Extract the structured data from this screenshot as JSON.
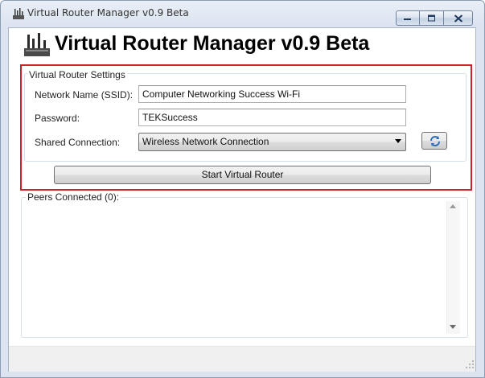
{
  "window": {
    "title": "Virtual Router Manager v0.9 Beta"
  },
  "header": {
    "heading": "Virtual Router Manager v0.9 Beta"
  },
  "settings": {
    "group_label": "Virtual Router Settings",
    "ssid_label": "Network Name (SSID):",
    "ssid_value": "Computer Networking Success Wi-Fi",
    "password_label": "Password:",
    "password_value": "TEKSuccess",
    "shared_label": "Shared Connection:",
    "shared_value": "Wireless Network Connection"
  },
  "actions": {
    "start_label": "Start Virtual Router"
  },
  "peers": {
    "label": "Peers Connected (0):"
  },
  "icons": {
    "app": "wifi-router-icon",
    "refresh": "refresh-icon",
    "dropdown": "chevron-down-icon"
  },
  "colors": {
    "highlight_border": "#d0202a"
  }
}
